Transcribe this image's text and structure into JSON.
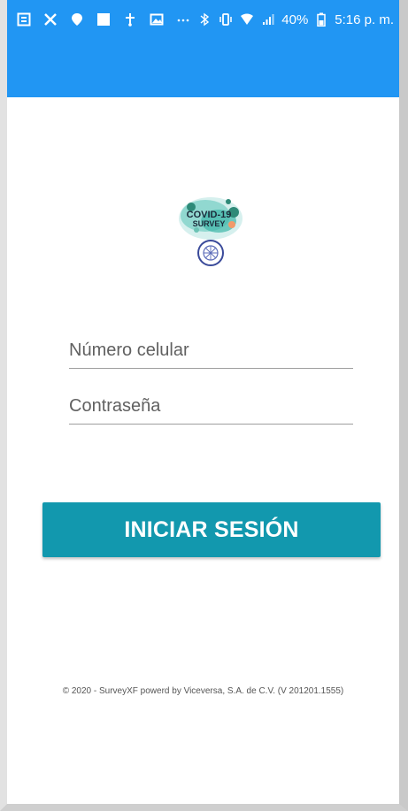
{
  "status_bar": {
    "battery": "40%",
    "time": "5:16 p. m.",
    "left_icons": [
      "notes-icon",
      "tools-icon",
      "location-icon",
      "square-icon",
      "usb-icon",
      "gallery-icon",
      "more-icon"
    ],
    "right_icons": [
      "bluetooth-icon",
      "vibrate-icon",
      "wifi-icon",
      "signal-icon",
      "battery-icon"
    ]
  },
  "colors": {
    "primary": "#2196f3",
    "button": "#1298ae"
  },
  "logo": {
    "text_line1": "COVID-19",
    "text_line2": "SURVEY"
  },
  "form": {
    "phone_placeholder": "Número celular",
    "password_placeholder": "Contraseña",
    "submit_label": "INICIAR SESIÓN"
  },
  "footer": {
    "text": "© 2020 - SurveyXF powerd by Viceversa, S.A. de C.V. (V 201201.1555)"
  }
}
